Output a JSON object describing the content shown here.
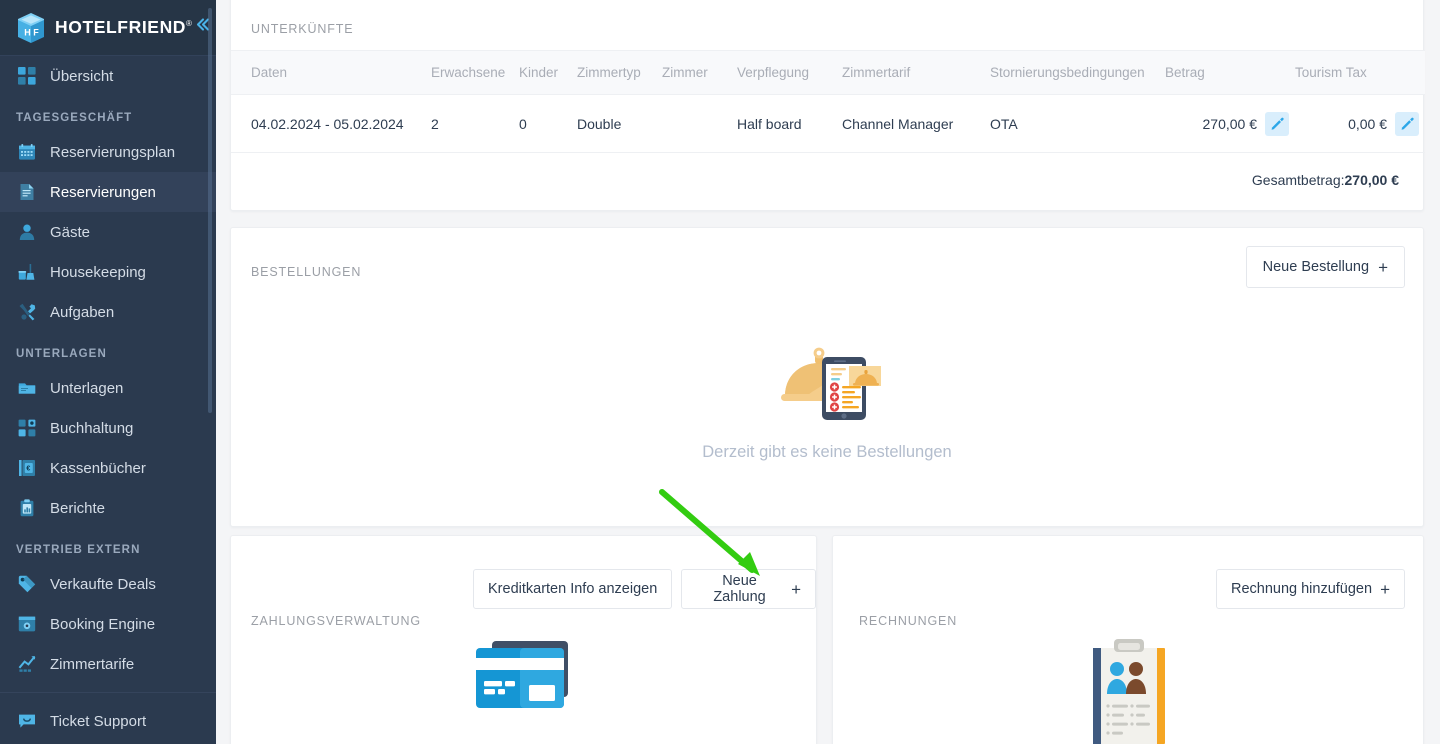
{
  "brand": {
    "name": "HOTELFRIEND",
    "registered_mark": "®",
    "logo_icon": "hotelfriend-cube-logo",
    "collapse_icon": "chevron-double-left-icon",
    "accent": "#4ab3e8",
    "sidebar_bg": "#2b3a4f"
  },
  "sidebar": {
    "items": [
      {
        "label": "Übersicht",
        "icon": "dashboard-grid-icon",
        "type": "item",
        "active": false
      },
      {
        "label": "TAGESGESCHÄFT",
        "type": "section"
      },
      {
        "label": "Reservierungsplan",
        "icon": "calendar-icon",
        "type": "item",
        "active": false
      },
      {
        "label": "Reservierungen",
        "icon": "document-lines-icon",
        "type": "item",
        "active": true
      },
      {
        "label": "Gäste",
        "icon": "user-person-icon",
        "type": "item",
        "active": false
      },
      {
        "label": "Housekeeping",
        "icon": "broom-bucket-icon",
        "type": "item",
        "active": false
      },
      {
        "label": "Aufgaben",
        "icon": "wrench-screwdriver-icon",
        "type": "item",
        "active": false
      },
      {
        "label": "UNTERLAGEN",
        "type": "section"
      },
      {
        "label": "Unterlagen",
        "icon": "folder-icon",
        "type": "item",
        "active": false
      },
      {
        "label": "Buchhaltung",
        "icon": "accounting-blocks-icon",
        "type": "item",
        "active": false
      },
      {
        "label": "Kassenbücher",
        "icon": "cash-book-icon",
        "type": "item",
        "active": false
      },
      {
        "label": "Berichte",
        "icon": "report-clipboard-icon",
        "type": "item",
        "active": false
      },
      {
        "label": "VERTRIEB EXTERN",
        "type": "section"
      },
      {
        "label": "Verkaufte Deals",
        "icon": "price-tag-icon",
        "type": "item",
        "active": false
      },
      {
        "label": "Booking Engine",
        "icon": "booking-engine-gear-icon",
        "type": "item",
        "active": false
      },
      {
        "label": "Zimmertarife",
        "icon": "chart-trend-up-icon",
        "type": "item",
        "active": false
      },
      {
        "label": "Ticket Support",
        "icon": "chat-bubble-smile-icon",
        "type": "item",
        "active": false,
        "separator_above": true
      }
    ]
  },
  "accommodations": {
    "section_label": "UNTERKÜNFTE",
    "columns": [
      "Daten",
      "Erwachsene",
      "Kinder",
      "Zimmertyp",
      "Zimmer",
      "Verpflegung",
      "Zimmertarif",
      "Stornierungsbedingungen",
      "Betrag",
      "Tourism Tax"
    ],
    "rows": [
      {
        "daten": "04.02.2024 - 05.02.2024",
        "erwachsene": "2",
        "kinder": "0",
        "zimmertyp": "Double",
        "zimmer": "",
        "verpflegung": "Half board",
        "zimmertarif": "Channel Manager",
        "stornierungsbedingungen": "OTA",
        "betrag": "270,00 €",
        "betrag_edit_icon": "pencil-icon",
        "tourism_tax": "0,00 €",
        "tourism_tax_edit_icon": "pencil-icon"
      }
    ],
    "total_label": "Gesamtbetrag:",
    "total_value": "270,00 €"
  },
  "orders": {
    "section_label": "BESTELLUNGEN",
    "new_order_button": "Neue Bestellung",
    "new_order_plus": "+",
    "empty_text": "Derzeit gibt es keine Bestellungen",
    "empty_illustration": "room-service-tray-phone-illustration"
  },
  "payments": {
    "section_label": "ZAHLUNGSVERWALTUNG",
    "show_cc_button": "Kreditkarten Info anzeigen",
    "new_payment_button": "Neue Zahlung",
    "new_payment_plus": "+",
    "illustration": "credit-cards-illustration"
  },
  "invoices": {
    "section_label": "RECHNUNGEN",
    "add_invoice_button": "Rechnung hinzufügen",
    "add_invoice_plus": "+",
    "illustration": "invoice-clipboard-person-illustration"
  },
  "annotation": {
    "arrow_color": "#33cc11",
    "arrow_target": "Kreditkarten Info anzeigen"
  }
}
